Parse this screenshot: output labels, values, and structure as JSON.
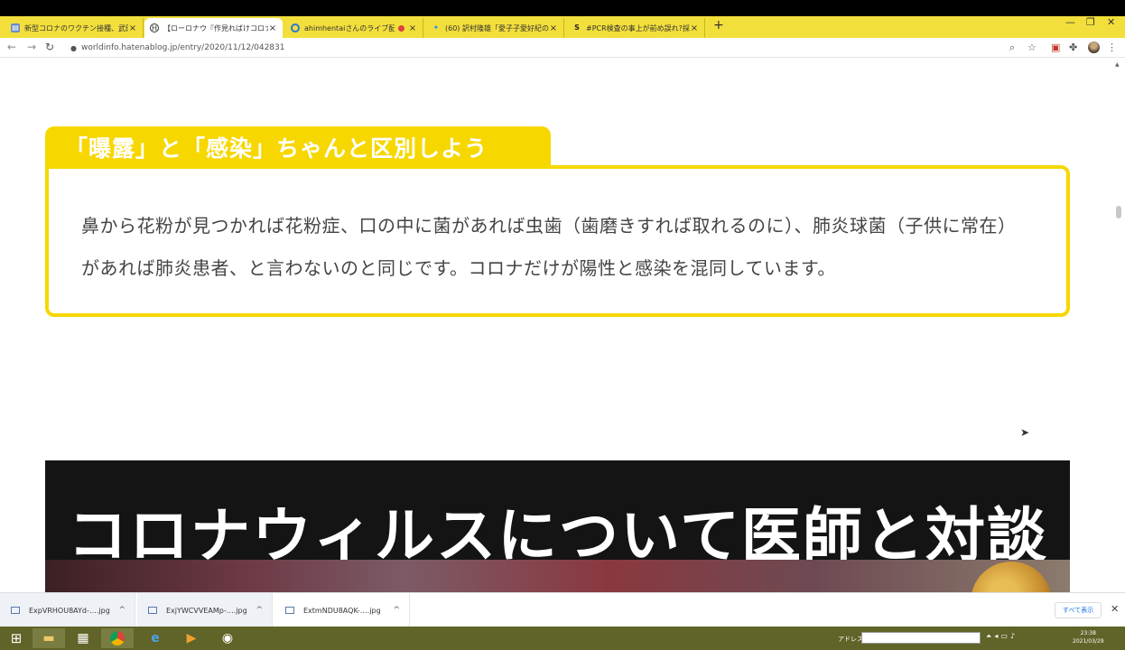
{
  "browser": {
    "tabs": [
      {
        "title": "新型コロナのワクチン接種、武田田…",
        "icon": "page-icon",
        "active": false
      },
      {
        "title": "【ローロナウ『作見ればけコロナ脱却の…",
        "icon": "hatena-icon",
        "active": true
      },
      {
        "title": "ahimhentaiさんのライブ配信",
        "icon": "chrome-circle-icon",
        "active": false
      },
      {
        "title": "(60) 訳村隆雄「愛子子愛好紀の…",
        "icon": "twitter-bird-icon",
        "active": false
      },
      {
        "title": "#PCR検査の事上が前め誤れ?採用",
        "icon": "s-logo-icon",
        "active": false
      }
    ],
    "url": "worldinfo.hatenablog.jp/entry/2020/11/12/042831"
  },
  "article": {
    "heading": "「曝露」と「感染」ちゃんと区別しよう",
    "body": "鼻から花粉が見つかれば花粉症、口の中に菌があれば虫歯（歯磨きすれば取れるのに）、肺炎球菌（子供に常在）があれば肺炎患者、と言わないのと同じです。コロナだけが陽性と感染を混同しています。",
    "banner_title": "コロナウィルスについて医師と対談"
  },
  "downloads": {
    "items": [
      {
        "name": "ExpVRHOU8AYd-….jpg"
      },
      {
        "name": "ExjYWCVVEAMp-….jpg"
      },
      {
        "name": "ExtmNDU8AQK-….jpg"
      }
    ],
    "show_all": "すべて表示"
  },
  "taskbar": {
    "address_label": "アドレス",
    "time": "23:38",
    "date": "2021/03/29"
  },
  "colors": {
    "tab_bar": "#f3df3b",
    "accent_yellow": "#f7d700",
    "taskbar": "#606428"
  }
}
